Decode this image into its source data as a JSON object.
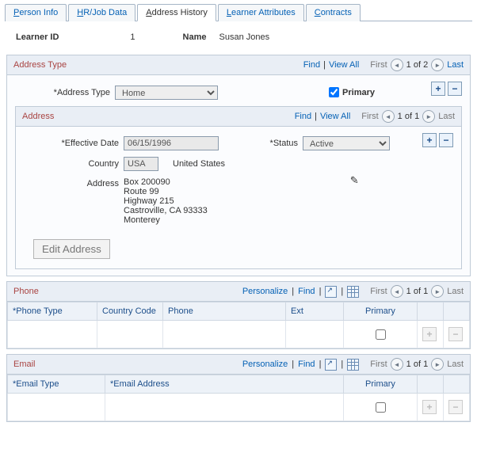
{
  "tabs": {
    "person_info": "Person Info",
    "hr_job_data": "HR/Job Data",
    "address_history": "Address History",
    "learner_attributes": "Learner Attributes",
    "contracts": "Contracts"
  },
  "header": {
    "learner_id_label": "Learner ID",
    "learner_id_value": "1",
    "name_label": "Name",
    "name_value": "Susan Jones"
  },
  "address_type_panel": {
    "title": "Address Type",
    "find": "Find",
    "view_all": "View All",
    "first": "First",
    "pager_text": "1 of 2",
    "last": "Last",
    "address_type_label": "Address Type",
    "address_type_value": "Home",
    "primary_label": "Primary",
    "primary_checked": true
  },
  "address_panel": {
    "title": "Address",
    "find": "Find",
    "view_all": "View All",
    "first": "First",
    "pager_text": "1 of 1",
    "last": "Last",
    "effective_date_label": "Effective Date",
    "effective_date_value": "06/15/1996",
    "status_label": "Status",
    "status_value": "Active",
    "country_label": "Country",
    "country_code": "USA",
    "country_name": "United States",
    "address_label": "Address",
    "address_lines": {
      "l1": "Box 200090",
      "l2": "Route 99",
      "l3": "Highway 215",
      "l4": "Castroville, CA 93333",
      "l5": "Monterey"
    },
    "edit_address_label": "Edit Address"
  },
  "phone_grid": {
    "title": "Phone",
    "personalize": "Personalize",
    "find": "Find",
    "first": "First",
    "pager_text": "1 of 1",
    "last": "Last",
    "col_phone_type": "Phone Type",
    "col_country_code": "Country Code",
    "col_phone": "Phone",
    "col_ext": "Ext",
    "col_primary": "Primary"
  },
  "email_grid": {
    "title": "Email",
    "personalize": "Personalize",
    "find": "Find",
    "first": "First",
    "pager_text": "1 of 1",
    "last": "Last",
    "col_email_type": "Email Type",
    "col_email_address": "Email Address",
    "col_primary": "Primary"
  },
  "common": {
    "sep": " | "
  }
}
